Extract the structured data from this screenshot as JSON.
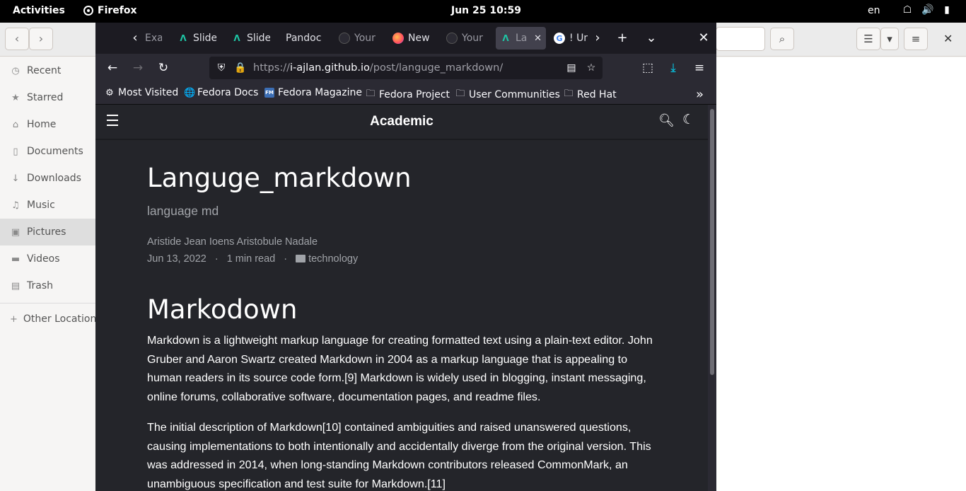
{
  "topbar": {
    "activities": "Activities",
    "app_name": "Firefox",
    "clock": "Jun 25  10:59",
    "lang": "en",
    "tray_icons": [
      "network-icon",
      "volume-icon",
      "battery-icon"
    ]
  },
  "files": {
    "sidebar": [
      {
        "label": "Recent",
        "icon": "clock-icon"
      },
      {
        "label": "Starred",
        "icon": "star-icon"
      },
      {
        "label": "Home",
        "icon": "home-icon"
      },
      {
        "label": "Documents",
        "icon": "document-icon"
      },
      {
        "label": "Downloads",
        "icon": "download-icon"
      },
      {
        "label": "Music",
        "icon": "music-icon"
      },
      {
        "label": "Pictures",
        "icon": "camera-icon"
      },
      {
        "label": "Videos",
        "icon": "video-icon"
      },
      {
        "label": "Trash",
        "icon": "trash-icon"
      },
      {
        "label": "Other Locations",
        "icon": "plus-icon"
      }
    ]
  },
  "firefox": {
    "tabs": [
      {
        "label": "Exam",
        "icon": "arrow-icon"
      },
      {
        "label": "Slides",
        "icon": "academic-icon"
      },
      {
        "label": "Slides",
        "icon": "academic-icon"
      },
      {
        "label": "Pandoc",
        "icon": ""
      },
      {
        "label": "Your",
        "icon": "github-icon"
      },
      {
        "label": "New",
        "icon": "firefox-icon"
      },
      {
        "label": "Your",
        "icon": "github-icon"
      },
      {
        "label": "Lang",
        "icon": "academic-icon"
      },
      {
        "label": "! Un",
        "icon": "google-icon"
      }
    ],
    "active_tab_index": 7,
    "url": {
      "prefix": "https://",
      "host": "i-ajlan.github.io",
      "path": "/post/languge_markdown/"
    },
    "bookmarks": [
      {
        "label": "Most Visited",
        "icon": "gear-icon"
      },
      {
        "label": "Fedora Docs",
        "icon": "globe-icon"
      },
      {
        "label": "Fedora Magazine",
        "icon": "fm-icon"
      },
      {
        "label": "Fedora Project",
        "icon": "folder-icon"
      },
      {
        "label": "User Communities",
        "icon": "folder-icon"
      },
      {
        "label": "Red Hat",
        "icon": "folder-icon"
      }
    ]
  },
  "site": {
    "brand": "Academic"
  },
  "article": {
    "title": "Languge_markdown",
    "subtitle": "language md",
    "authors": "Aristide Jean Ioens Aristobule Nadale",
    "date": "Jun 13, 2022",
    "read_time": "1 min read",
    "category": "technology",
    "heading": "Markodown",
    "paragraphs": [
      "Markdown is a lightweight markup language for creating formatted text using a plain-text editor. John Gruber and Aaron Swartz created Markdown in 2004 as a markup language that is appealing to human readers in its source code form.[9] Markdown is widely used in blogging, instant messaging, online forums, collaborative software, documentation pages, and readme files.",
      "The initial description of Markdown[10] contained ambiguities and raised unanswered questions, causing implementations to both intentionally and accidentally diverge from the original version. This was addressed in 2014, when long-standing Markdown contributors released CommonMark, an unambiguous specification and test suite for Markdown.[11]"
    ]
  },
  "colors": {
    "firefox_bg": "#1c1b22",
    "toolbar_bg": "#2b2a33",
    "page_bg": "#24252a",
    "muted_text": "#a0a3a8",
    "academic_accent": "#1ec7a6"
  }
}
